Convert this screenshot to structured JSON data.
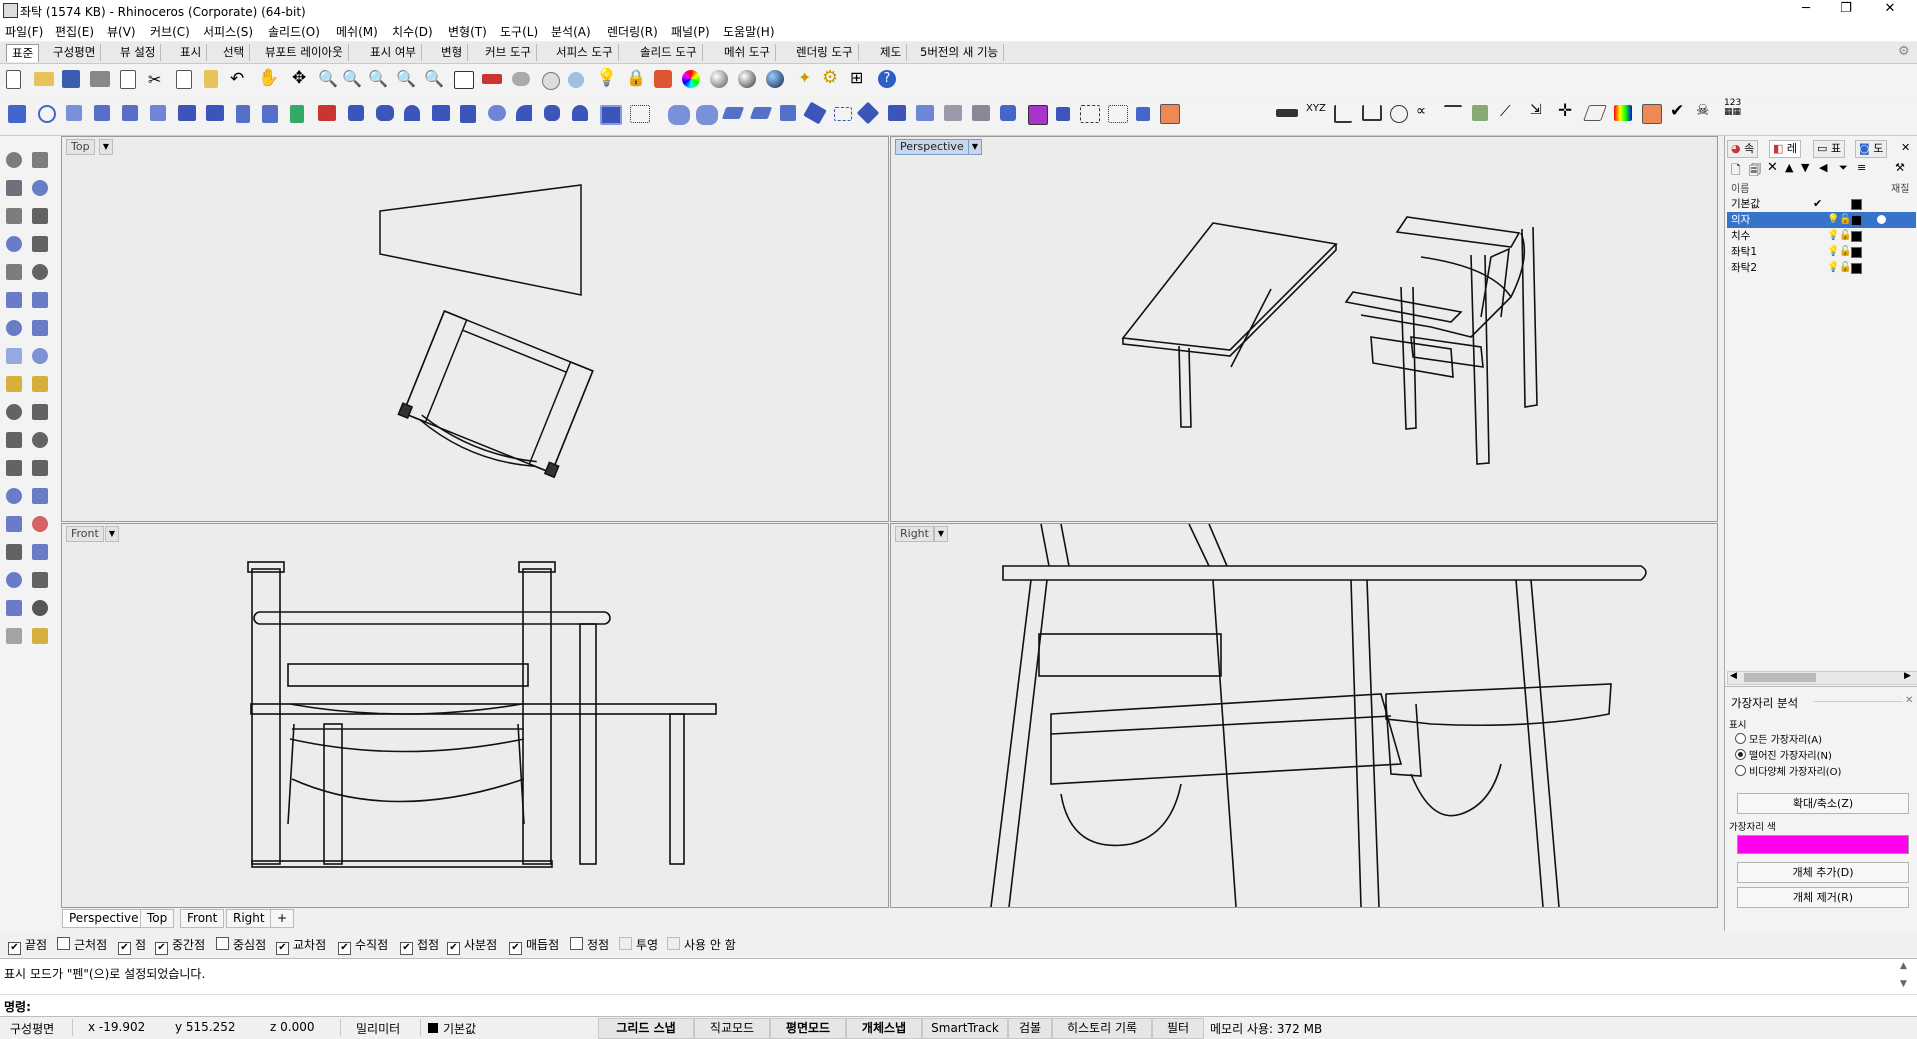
{
  "window": {
    "title": "좌탁 (1574 KB) - Rhinoceros (Corporate) (64-bit)",
    "buttons": [
      "─",
      "❐",
      "✕"
    ]
  },
  "menu": [
    "파일(F)",
    "편집(E)",
    "뷰(V)",
    "커브(C)",
    "서피스(S)",
    "솔리드(O)",
    "메쉬(M)",
    "치수(D)",
    "변형(T)",
    "도구(L)",
    "분석(A)",
    "렌더링(R)",
    "패널(P)",
    "도움말(H)"
  ],
  "toolbar_tabs": [
    "표준",
    "구성평면",
    "뷰 설정",
    "표시",
    "선택",
    "뷰포트 레이아웃",
    "표시 여부",
    "변형",
    "커브 도구",
    "서피스 도구",
    "솔리드 도구",
    "메쉬 도구",
    "렌더링 도구",
    "제도",
    "5버전의 새 기능"
  ],
  "active_toolbar_tab": "표준",
  "viewports": {
    "top": "Top",
    "perspective": "Perspective",
    "front": "Front",
    "right": "Right",
    "active": "Perspective"
  },
  "viewport_tabs": [
    "Perspective",
    "Top",
    "Front",
    "Right"
  ],
  "viewport_tab_add": "+",
  "osnap": [
    {
      "label": "끝점",
      "checked": true
    },
    {
      "label": "근처점",
      "checked": false
    },
    {
      "label": "점",
      "checked": true
    },
    {
      "label": "중간점",
      "checked": true
    },
    {
      "label": "중심점",
      "checked": false
    },
    {
      "label": "교차점",
      "checked": true
    },
    {
      "label": "수직점",
      "checked": true
    },
    {
      "label": "접점",
      "checked": true
    },
    {
      "label": "사분점",
      "checked": true
    },
    {
      "label": "매듭점",
      "checked": true
    },
    {
      "label": "정점",
      "checked": false
    },
    {
      "label": "투영",
      "checked": false
    },
    {
      "label": "사용 안 함",
      "checked": false
    }
  ],
  "command": {
    "history": "표시 모드가 \"펜\"(으)로 설정되었습니다.",
    "prompt": "명령:"
  },
  "status": {
    "cplane": "구성평면",
    "x": "x -19.902",
    "y": "y 515.252",
    "z": "z 0.000",
    "units": "밀리미터",
    "layer": "기본값",
    "grid_snap": "그리드 스냅",
    "ortho": "직교모드",
    "planar": "평면모드",
    "osnap": "개체스냅",
    "smarttrack": "SmartTrack",
    "gumball": "검볼",
    "history": "히스토리 기록",
    "filter": "필터",
    "memory": "메모리 사용: 372 MB"
  },
  "panel": {
    "tabs": [
      "속",
      "레",
      "표",
      "도"
    ],
    "col_name": "이름",
    "col_material": "재질",
    "layers": [
      {
        "name": "기본값",
        "current": true,
        "color": "#000000"
      },
      {
        "name": "의자",
        "selected": true,
        "color": "#000000"
      },
      {
        "name": "치수",
        "color": "#000000"
      },
      {
        "name": "좌탁1",
        "color": "#000000"
      },
      {
        "name": "좌탁2",
        "color": "#000000"
      }
    ],
    "current_mark": "✔",
    "edge_analysis": {
      "title": "가장자리 분석",
      "display_label": "표시",
      "options": [
        {
          "label": "모든 가장자리(A)",
          "on": false
        },
        {
          "label": "떨어진 가장자리(N)",
          "on": true
        },
        {
          "label": "비다양체 가장자리(O)",
          "on": false
        }
      ],
      "zoom_button": "확대/축소(Z)",
      "edge_color_label": "가장자리 색",
      "edge_color": "#ff00ee",
      "add_button": "개체 추가(D)",
      "remove_button": "개체 제거(R)"
    }
  },
  "colors": {
    "selection": "#3574c8",
    "viewport_bg": "#ececea",
    "edge_color": "#ff00ee"
  }
}
